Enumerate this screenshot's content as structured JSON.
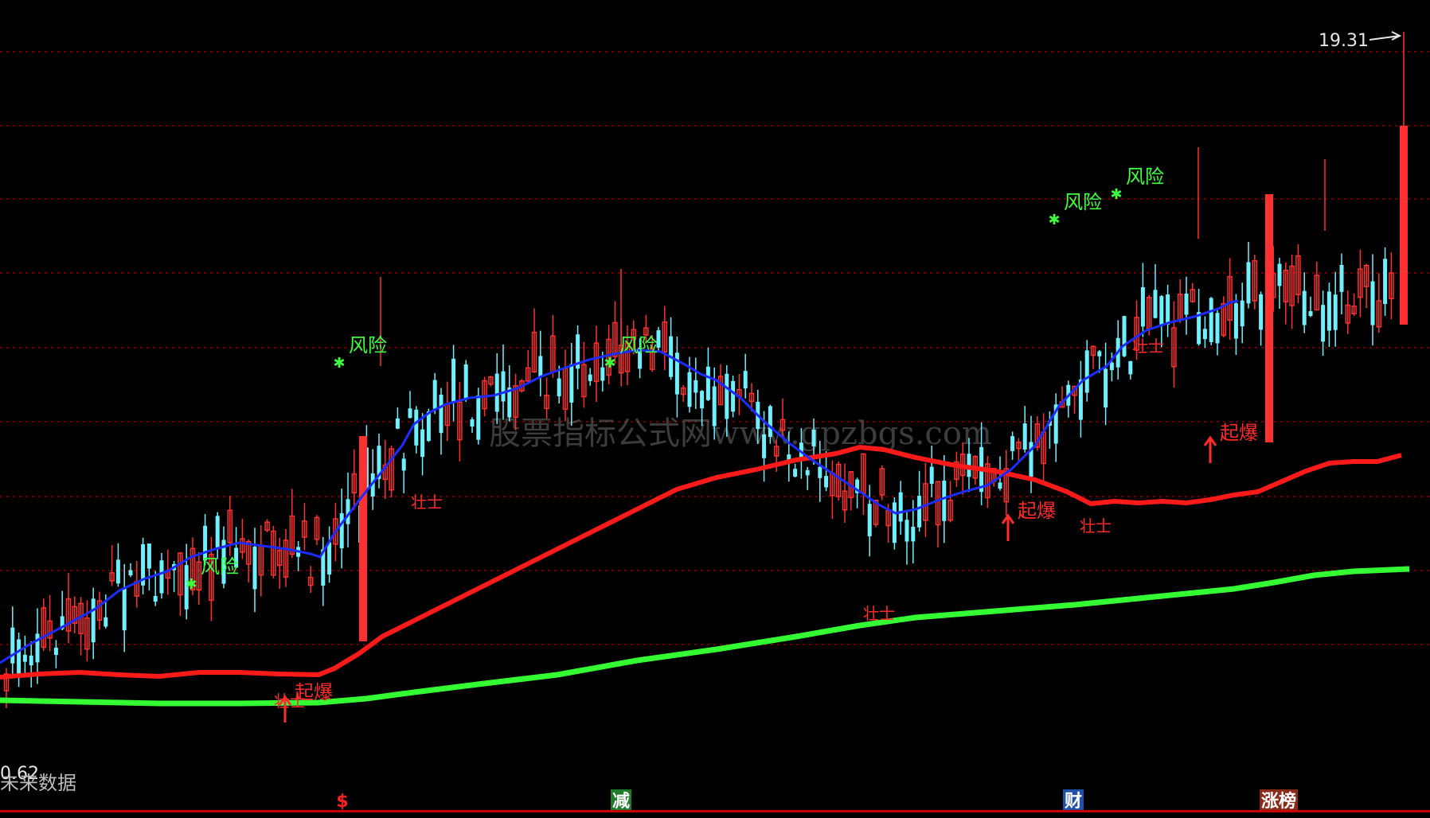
{
  "watermark": "股票指标公式网www.gpzbgs.com",
  "status_text": "未来数据",
  "axis_labels": {
    "low": "0.62",
    "high": "19.31"
  },
  "signals": {
    "risk_label": "风险",
    "burst_label": "起爆",
    "warrior_label": "壮士",
    "risk_marks": [
      240,
      426,
      766,
      1324,
      1402
    ],
    "burst_marks": [
      358,
      1266,
      1520
    ],
    "warrior_marks": [
      358,
      530,
      1098,
      1370,
      1436
    ]
  },
  "footer_badges": [
    {
      "label": "$",
      "color": "#ff2020",
      "bg": "#000000"
    },
    {
      "label": "减",
      "color": "#ffffff",
      "bg": "#1f7a2a"
    },
    {
      "label": "财",
      "color": "#ffffff",
      "bg": "#1f4fa8"
    },
    {
      "label": "涨榜",
      "color": "#ffffff",
      "bg": "#8a2a18"
    }
  ],
  "colors": {
    "up": "#ff3030",
    "down": "#6ff0ff",
    "ma_short": "#1c2cff",
    "ma_mid": "#ff1a1a",
    "ma_long": "#33ff33",
    "grid": "#8b0000",
    "risk": "#3dff3d",
    "signal": "#ff2a2a"
  },
  "chart_data": {
    "type": "candlestick",
    "price_range": [
      0.62,
      19.31
    ],
    "grid_levels": 9,
    "candles": []
  }
}
